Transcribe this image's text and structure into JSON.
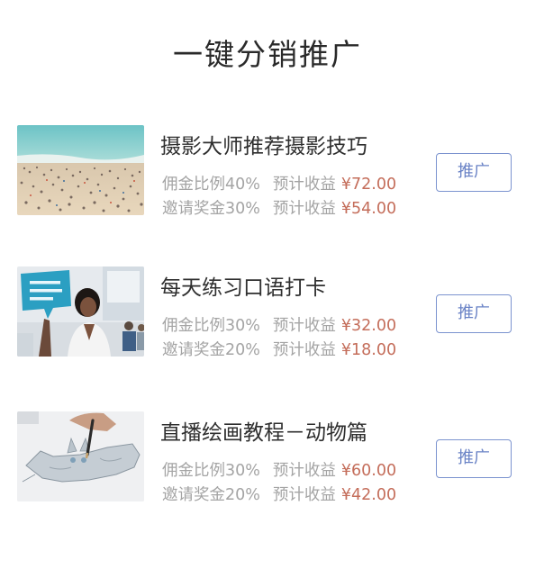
{
  "page": {
    "title": "一键分销推广"
  },
  "items": [
    {
      "name": "摄影大师推荐摄影技巧",
      "commission_label": "佣金比例40%",
      "commission_expect_label": "预计收益",
      "commission_amount": "¥72.00",
      "invite_label": "邀请奖金30%",
      "invite_expect_label": "预计收益",
      "invite_amount": "¥54.00",
      "button_label": "推广",
      "image": "beach-crowd-photo"
    },
    {
      "name": "每天练习口语打卡",
      "commission_label": "佣金比例30%",
      "commission_expect_label": "预计收益",
      "commission_amount": "¥32.00",
      "invite_label": "邀请奖金20%",
      "invite_expect_label": "预计收益",
      "invite_amount": "¥18.00",
      "button_label": "推广",
      "image": "speech-bubble-office-photo"
    },
    {
      "name": "直播绘画教程－动物篇",
      "commission_label": "佣金比例30%",
      "commission_expect_label": "预计收益",
      "commission_amount": "¥60.00",
      "invite_label": "邀请奖金20%",
      "invite_expect_label": "预计收益",
      "invite_amount": "¥42.00",
      "button_label": "推广",
      "image": "cat-drawing-photo"
    }
  ],
  "colors": {
    "price": "#c46d5a",
    "button_border": "#7b93cf",
    "button_text": "#6a83c6",
    "muted_text": "#a4a4a4"
  }
}
